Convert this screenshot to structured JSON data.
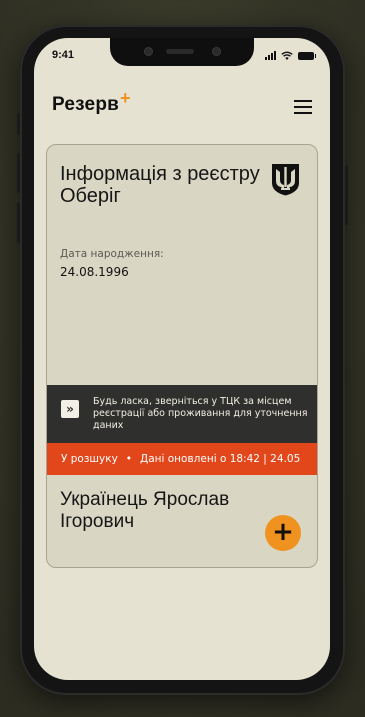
{
  "status_bar": {
    "time": "9:41"
  },
  "header": {
    "logo_text": "Резерв",
    "logo_plus": "+",
    "menu_icon": "hamburger-icon"
  },
  "card": {
    "title": "Інформація з реєстру Оберіг",
    "emblem_icon": "trident-icon",
    "dob_label": "Дата народження:",
    "dob_value": "24.08.1996",
    "notice": {
      "icon": "double-chevron-right-icon",
      "text": "Будь ласка, зверніться у ТЦК за місцем реєстрації або проживання для уточнення даних"
    },
    "ticker": {
      "status": "У розшуку",
      "separator": "•",
      "updated": "Дані оновлені о 18:42 | 24.05"
    },
    "person_name": "Українець Ярослав Ігорович",
    "add_button": "+"
  },
  "colors": {
    "background": "#e6e2d2",
    "card": "#d9d6c3",
    "notice": "#2f2f2d",
    "ticker": "#e2471c",
    "accent": "#f0921f"
  }
}
